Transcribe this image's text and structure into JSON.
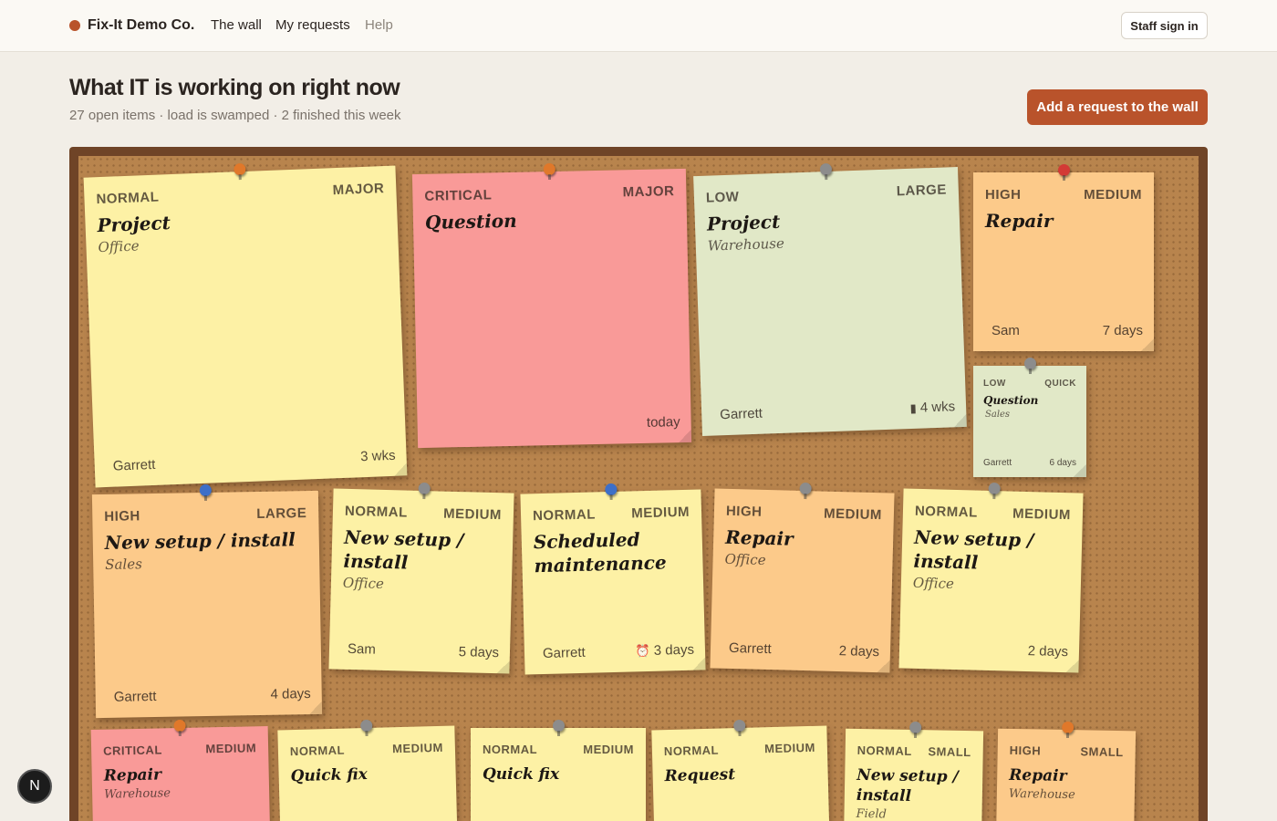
{
  "nav": {
    "brand": "Fix-It Demo Co.",
    "links": [
      "The wall",
      "My requests",
      "Help"
    ],
    "signin": "Staff sign in"
  },
  "header": {
    "title": "What IT is working on right now",
    "subtitle": "27 open items · load is swamped · 2 finished this week",
    "add_button": "Add a request to the wall"
  },
  "colors": {
    "accent": "#b9532b",
    "yellow": "#fdf1a5",
    "pink": "#f99a98",
    "green": "#e1e8c7",
    "orange": "#fcca8a",
    "cork": "#b8844d"
  },
  "notes": [
    {
      "priority": "NORMAL",
      "size": "MAJOR",
      "title": "Project",
      "location": "Office",
      "owner": "Garrett",
      "age": "3 wks",
      "age_icon": "",
      "color": "yellow",
      "pin": "orange"
    },
    {
      "priority": "CRITICAL",
      "size": "MAJOR",
      "title": "Question",
      "location": "",
      "owner": "",
      "age": "today",
      "age_icon": "",
      "color": "pink",
      "pin": "orange"
    },
    {
      "priority": "LOW",
      "size": "LARGE",
      "title": "Project",
      "location": "Warehouse",
      "owner": "Garrett",
      "age": "4 wks",
      "age_icon": "▮",
      "color": "green",
      "pin": "gray"
    },
    {
      "priority": "HIGH",
      "size": "MEDIUM",
      "title": "Repair",
      "location": "",
      "owner": "Sam",
      "age": "7 days",
      "age_icon": "",
      "color": "orange",
      "pin": "red"
    },
    {
      "priority": "LOW",
      "size": "QUICK",
      "title": "Question",
      "location": "Sales",
      "owner": "Garrett",
      "age": "6 days",
      "age_icon": "",
      "color": "green",
      "pin": "gray"
    },
    {
      "priority": "HIGH",
      "size": "LARGE",
      "title": "New setup / install",
      "location": "Sales",
      "owner": "Garrett",
      "age": "4 days",
      "age_icon": "",
      "color": "orange",
      "pin": "blue"
    },
    {
      "priority": "NORMAL",
      "size": "MEDIUM",
      "title": "New setup / install",
      "location": "Office",
      "owner": "Sam",
      "age": "5 days",
      "age_icon": "",
      "color": "yellow",
      "pin": "gray"
    },
    {
      "priority": "NORMAL",
      "size": "MEDIUM",
      "title": "Scheduled maintenance",
      "location": "",
      "owner": "Garrett",
      "age": "3 days",
      "age_icon": "⏰",
      "color": "yellow",
      "pin": "blue"
    },
    {
      "priority": "HIGH",
      "size": "MEDIUM",
      "title": "Repair",
      "location": "Office",
      "owner": "Garrett",
      "age": "2 days",
      "age_icon": "",
      "color": "orange",
      "pin": "gray"
    },
    {
      "priority": "NORMAL",
      "size": "MEDIUM",
      "title": "New setup / install",
      "location": "Office",
      "owner": "",
      "age": "2 days",
      "age_icon": "",
      "color": "yellow",
      "pin": "gray"
    },
    {
      "priority": "CRITICAL",
      "size": "MEDIUM",
      "title": "Repair",
      "location": "Warehouse",
      "owner": "",
      "age": "",
      "age_icon": "",
      "color": "pink",
      "pin": "orange"
    },
    {
      "priority": "NORMAL",
      "size": "MEDIUM",
      "title": "Quick fix",
      "location": "",
      "owner": "",
      "age": "",
      "age_icon": "",
      "color": "yellow",
      "pin": "gray"
    },
    {
      "priority": "NORMAL",
      "size": "MEDIUM",
      "title": "Quick fix",
      "location": "",
      "owner": "",
      "age": "",
      "age_icon": "",
      "color": "yellow",
      "pin": "gray"
    },
    {
      "priority": "NORMAL",
      "size": "MEDIUM",
      "title": "Request",
      "location": "",
      "owner": "",
      "age": "",
      "age_icon": "",
      "color": "yellow",
      "pin": "gray"
    },
    {
      "priority": "NORMAL",
      "size": "SMALL",
      "title": "New setup / install",
      "location": "Field",
      "owner": "",
      "age": "",
      "age_icon": "",
      "color": "yellow",
      "pin": "gray"
    },
    {
      "priority": "HIGH",
      "size": "SMALL",
      "title": "Repair",
      "location": "Warehouse",
      "owner": "",
      "age": "",
      "age_icon": "",
      "color": "orange",
      "pin": "orange"
    }
  ],
  "badge": "N"
}
